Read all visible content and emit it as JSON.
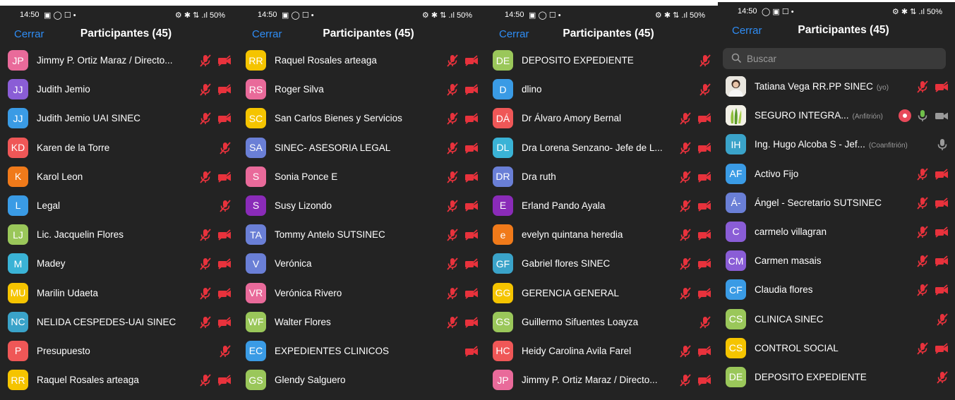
{
  "panels": [
    {
      "status": {
        "time": "14:50",
        "left_icons": "▣ ◯ ☐ •",
        "right": "⚙ ✱ ⇅ .ıl 50%"
      },
      "header": {
        "close": "Cerrar",
        "title": "Participantes (45)"
      },
      "participants": [
        {
          "initials": "JP",
          "color": "#e96a9a",
          "name": "Jimmy P. Ortiz Maraz / Directo...",
          "mic": true,
          "cam": true
        },
        {
          "initials": "JJ",
          "color": "#8a5dd6",
          "name": "Judith Jemio",
          "mic": true,
          "cam": true
        },
        {
          "initials": "JJ",
          "color": "#3a9be5",
          "name": "Judith Jemio UAI SINEC",
          "mic": true,
          "cam": true
        },
        {
          "initials": "KD",
          "color": "#ef5757",
          "name": "Karen de la Torre",
          "mic": true,
          "cam": false
        },
        {
          "initials": "K",
          "color": "#f07a1a",
          "name": "Karol Leon",
          "mic": true,
          "cam": true
        },
        {
          "initials": "L",
          "color": "#3a9be5",
          "name": "Legal",
          "mic": true,
          "cam": false
        },
        {
          "initials": "LJ",
          "color": "#9ac75a",
          "name": "Lic. Jacquelin Flores",
          "mic": true,
          "cam": true
        },
        {
          "initials": "M",
          "color": "#3ab3d6",
          "name": "Madey",
          "mic": true,
          "cam": true
        },
        {
          "initials": "MU",
          "color": "#f5c400",
          "name": "Marilin Udaeta",
          "mic": true,
          "cam": true
        },
        {
          "initials": "NC",
          "color": "#3aa3c9",
          "name": "NELIDA CESPEDES-UAI SINEC",
          "mic": true,
          "cam": true
        },
        {
          "initials": "P",
          "color": "#ef5757",
          "name": "Presupuesto",
          "mic": true,
          "cam": false
        },
        {
          "initials": "RR",
          "color": "#f5c400",
          "name": "Raquel Rosales arteaga",
          "mic": true,
          "cam": true
        }
      ]
    },
    {
      "status": {
        "time": "14:50",
        "left_icons": "▣ ◯ ☐ •",
        "right": "⚙ ✱ ⇅ .ıl 50%"
      },
      "header": {
        "close": "Cerrar",
        "title": "Participantes (45)"
      },
      "participants": [
        {
          "initials": "RR",
          "color": "#f5c400",
          "name": "Raquel Rosales arteaga",
          "mic": true,
          "cam": true
        },
        {
          "initials": "RS",
          "color": "#e96a9a",
          "name": "Roger Silva",
          "mic": true,
          "cam": true
        },
        {
          "initials": "SC",
          "color": "#f5c400",
          "name": "San Carlos Bienes y Servicios",
          "mic": true,
          "cam": true
        },
        {
          "initials": "SA",
          "color": "#6a7fd6",
          "name": "SINEC- ASESORIA LEGAL",
          "mic": true,
          "cam": true
        },
        {
          "initials": "S",
          "color": "#e96a9a",
          "name": "Sonia Ponce E",
          "mic": true,
          "cam": true
        },
        {
          "initials": "S",
          "color": "#8a2bb8",
          "name": "Susy Lizondo",
          "mic": true,
          "cam": true
        },
        {
          "initials": "TA",
          "color": "#6a7fd6",
          "name": "Tommy Antelo SUTSINEC",
          "mic": true,
          "cam": true
        },
        {
          "initials": "V",
          "color": "#6a7fd6",
          "name": "Verónica",
          "mic": true,
          "cam": true
        },
        {
          "initials": "VR",
          "color": "#e96a9a",
          "name": "Verónica Rivero",
          "mic": true,
          "cam": true
        },
        {
          "initials": "WF",
          "color": "#9ac75a",
          "name": "Walter Flores",
          "mic": true,
          "cam": true
        },
        {
          "initials": "EC",
          "color": "#3a9be5",
          "name": "EXPEDIENTES CLINICOS",
          "mic": false,
          "cam": true
        },
        {
          "initials": "GS",
          "color": "#9ac75a",
          "name": "Glendy Salguero",
          "mic": false,
          "cam": false
        }
      ]
    },
    {
      "status": {
        "time": "14:50",
        "left_icons": "▣ ◯ ☐ •",
        "right": "⚙ ✱ ⇅ .ıl 50%"
      },
      "header": {
        "close": "Cerrar",
        "title": "Participantes (45)"
      },
      "participants": [
        {
          "initials": "DE",
          "color": "#9ac75a",
          "name": "DEPOSITO EXPEDIENTE",
          "mic": true,
          "cam": false
        },
        {
          "initials": "D",
          "color": "#3a9be5",
          "name": "dlino",
          "mic": true,
          "cam": false
        },
        {
          "initials": "DÁ",
          "color": "#ef5757",
          "name": "Dr Álvaro Amory Bernal",
          "mic": true,
          "cam": true
        },
        {
          "initials": "DL",
          "color": "#3ab3d6",
          "name": "Dra Lorena Senzano- Jefe de L...",
          "mic": true,
          "cam": true
        },
        {
          "initials": "DR",
          "color": "#6a7fd6",
          "name": "Dra ruth",
          "mic": true,
          "cam": true
        },
        {
          "initials": "E",
          "color": "#8a2bb8",
          "name": "Erland Pando Ayala",
          "mic": true,
          "cam": true
        },
        {
          "initials": "e",
          "color": "#f07a1a",
          "name": "evelyn quintana heredia",
          "mic": true,
          "cam": true
        },
        {
          "initials": "GF",
          "color": "#3aa3c9",
          "name": "Gabriel flores SINEC",
          "mic": true,
          "cam": true
        },
        {
          "initials": "GG",
          "color": "#f5c400",
          "name": "GERENCIA GENERAL",
          "mic": true,
          "cam": true
        },
        {
          "initials": "GS",
          "color": "#9ac75a",
          "name": "Guillermo Sifuentes Loayza",
          "mic": true,
          "cam": false
        },
        {
          "initials": "HC",
          "color": "#ef5757",
          "name": "Heidy Carolina Avila Farel",
          "mic": true,
          "cam": true
        },
        {
          "initials": "JP",
          "color": "#e96a9a",
          "name": "Jimmy P. Ortiz Maraz / Directo...",
          "mic": true,
          "cam": true
        }
      ]
    },
    {
      "status": {
        "time": "14:50",
        "left_icons": "◯ ▣ ☐ •",
        "right": "⚙ ✱ ⇅ .ıl 50%"
      },
      "header": {
        "close": "Cerrar",
        "title": "Participantes (45)"
      },
      "search": {
        "placeholder": "Buscar"
      },
      "participants": [
        {
          "initials": "",
          "photo": "person",
          "color": "#f0eee8",
          "name": "Tatiana Vega RR.PP SINEC",
          "role": "(yo)",
          "mic": true,
          "cam": true
        },
        {
          "initials": "",
          "photo": "logo",
          "color": "#f0eee8",
          "name": "SEGURO INTEGRA...",
          "role": "(Anfitrión)",
          "rec": true,
          "mic_on": true,
          "cam_on": true
        },
        {
          "initials": "IH",
          "color": "#3aa3c9",
          "name": "Ing. Hugo Alcoba S - Jef...",
          "role": "(Coanfitrión)",
          "mic_on": true
        },
        {
          "initials": "AF",
          "color": "#3a9be5",
          "name": "Activo Fijo",
          "mic": true,
          "cam": true
        },
        {
          "initials": "Á-",
          "color": "#6a7fd6",
          "name": "Ángel - Secretario SUTSINEC",
          "mic": true,
          "cam": true
        },
        {
          "initials": "C",
          "color": "#8a5dd6",
          "name": "carmelo villagran",
          "mic": true,
          "cam": true
        },
        {
          "initials": "CM",
          "color": "#8a5dd6",
          "name": "Carmen masais",
          "mic": true,
          "cam": true
        },
        {
          "initials": "CF",
          "color": "#3a9be5",
          "name": "Claudia flores",
          "mic": true,
          "cam": true
        },
        {
          "initials": "CS",
          "color": "#9ac75a",
          "name": "CLINICA SINEC",
          "mic": true,
          "cam": false
        },
        {
          "initials": "CS",
          "color": "#f5c400",
          "name": "CONTROL SOCIAL",
          "mic": true,
          "cam": true
        },
        {
          "initials": "DE",
          "color": "#9ac75a",
          "name": "DEPOSITO EXPEDIENTE",
          "mic": true,
          "cam": false
        }
      ]
    }
  ],
  "colors": {
    "muted": "#e8323c",
    "link": "#2f8df5",
    "bg": "#232323"
  }
}
